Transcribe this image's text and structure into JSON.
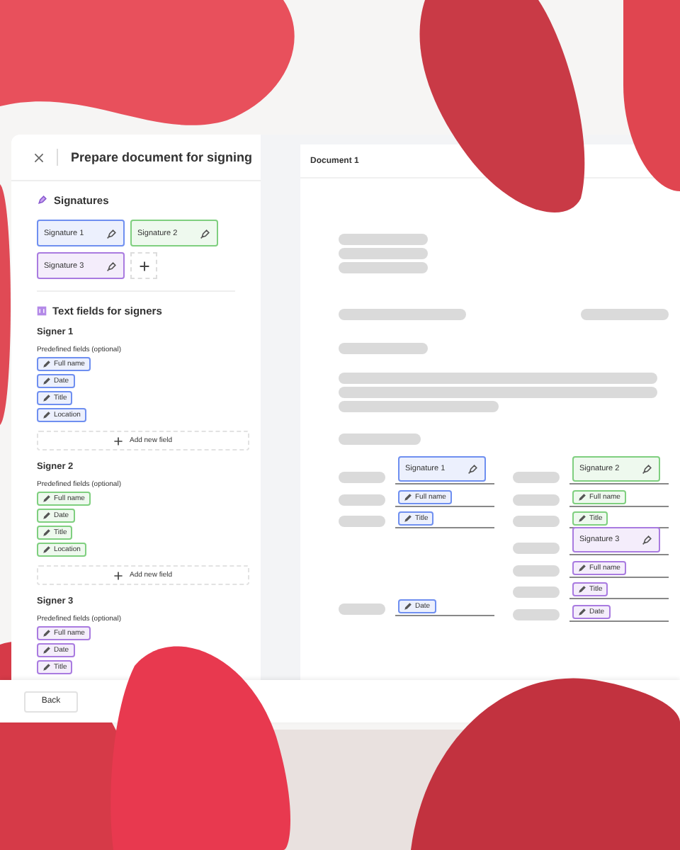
{
  "dialog": {
    "title": "Prepare document for signing"
  },
  "signatures": {
    "heading": "Signatures",
    "items": [
      {
        "label": "Signature 1",
        "color": "#6f8ff0"
      },
      {
        "label": "Signature 2",
        "color": "#7fcf7f"
      },
      {
        "label": "Signature 3",
        "color": "#a97be0"
      }
    ]
  },
  "text_fields": {
    "heading": "Text fields for signers",
    "signers": [
      {
        "name": "Signer 1",
        "hint": "Predefined fields (optional)",
        "color": "#6f8ff0",
        "fields": [
          "Full name",
          "Date",
          "Title",
          "Location"
        ],
        "add_button": "Add new field"
      },
      {
        "name": "Signer 2",
        "hint": "Predefined fields (optional)",
        "color": "#7fcf7f",
        "fields": [
          "Full name",
          "Date",
          "Title",
          "Location"
        ],
        "add_button": "Add new field"
      },
      {
        "name": "Signer 3",
        "hint": "Predefined fields (optional)",
        "color": "#a97be0",
        "fields": [
          "Full name",
          "Date",
          "Title"
        ]
      }
    ]
  },
  "document": {
    "title": "Document 1",
    "columns": [
      {
        "entries": [
          {
            "kind": "signature",
            "label": "Signature 1",
            "color": "#6f8ff0"
          },
          {
            "kind": "field",
            "label": "Full name",
            "color": "#6f8ff0"
          },
          {
            "kind": "field",
            "label": "Title",
            "color": "#6f8ff0"
          },
          {
            "kind": "blank"
          },
          {
            "kind": "blank"
          },
          {
            "kind": "blank"
          },
          {
            "kind": "field",
            "label": "Date",
            "color": "#6f8ff0"
          }
        ]
      },
      {
        "entries": [
          {
            "kind": "signature",
            "label": "Signature 2",
            "color": "#7fcf7f"
          },
          {
            "kind": "field",
            "label": "Full name",
            "color": "#7fcf7f"
          },
          {
            "kind": "field",
            "label": "Title",
            "color": "#7fcf7f"
          },
          {
            "kind": "signature",
            "label": "Signature 3",
            "color": "#a97be0"
          },
          {
            "kind": "field",
            "label": "Full name",
            "color": "#a97be0"
          },
          {
            "kind": "field",
            "label": "Title",
            "color": "#a97be0"
          },
          {
            "kind": "field",
            "label": "Date",
            "color": "#a97be0"
          }
        ]
      }
    ]
  },
  "footer": {
    "back_button": "Back"
  }
}
